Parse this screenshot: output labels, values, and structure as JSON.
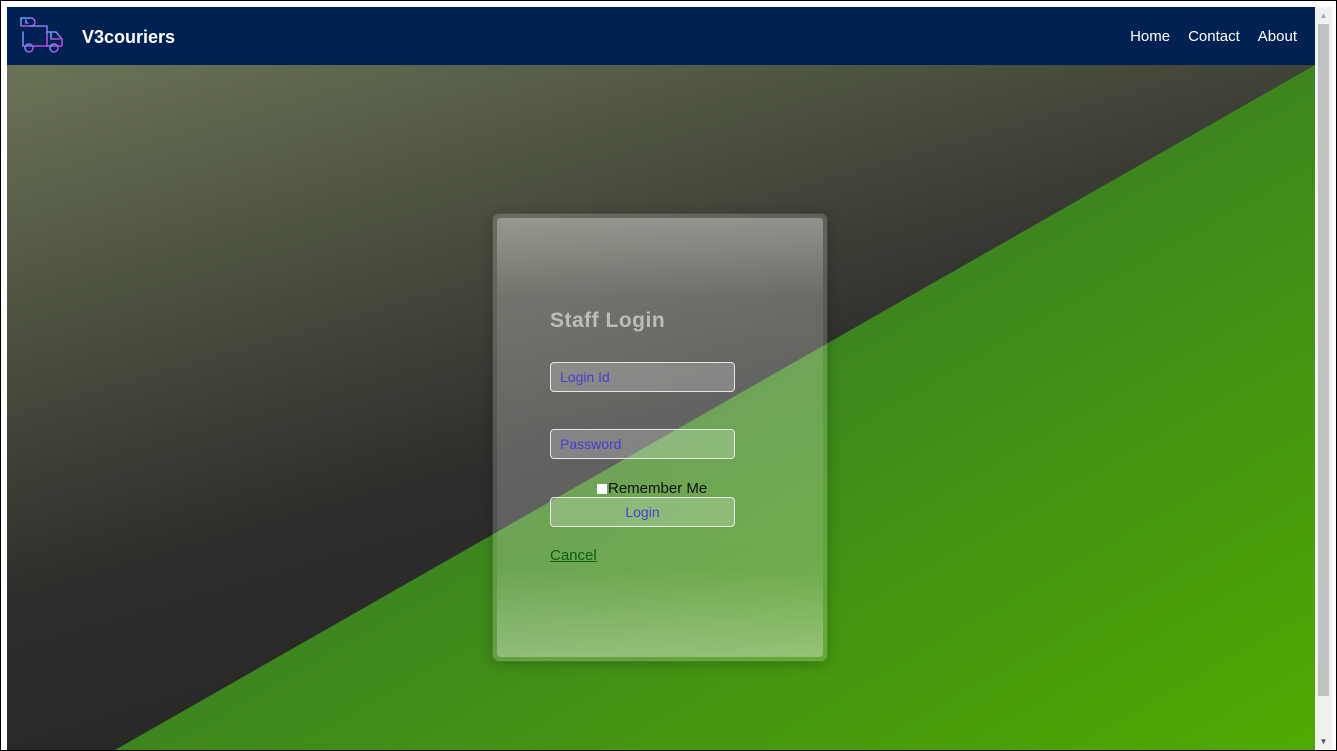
{
  "navbar": {
    "brand": "V3couriers",
    "links": [
      "Home",
      "Contact",
      "About"
    ]
  },
  "login": {
    "title": "Staff Login",
    "login_placeholder": "Login Id",
    "password_placeholder": "Password",
    "remember_label": "Remember Me",
    "login_button": "Login",
    "cancel_link": "Cancel"
  },
  "colors": {
    "navbar": "#012153",
    "accent_text": "#4a3cd6",
    "green": "#4aa000",
    "dark": "#2a2a2a"
  },
  "icons": {
    "brand_logo": "delivery-truck-icon",
    "scroll_up": "triangle-up-icon",
    "scroll_down": "triangle-down-icon"
  }
}
